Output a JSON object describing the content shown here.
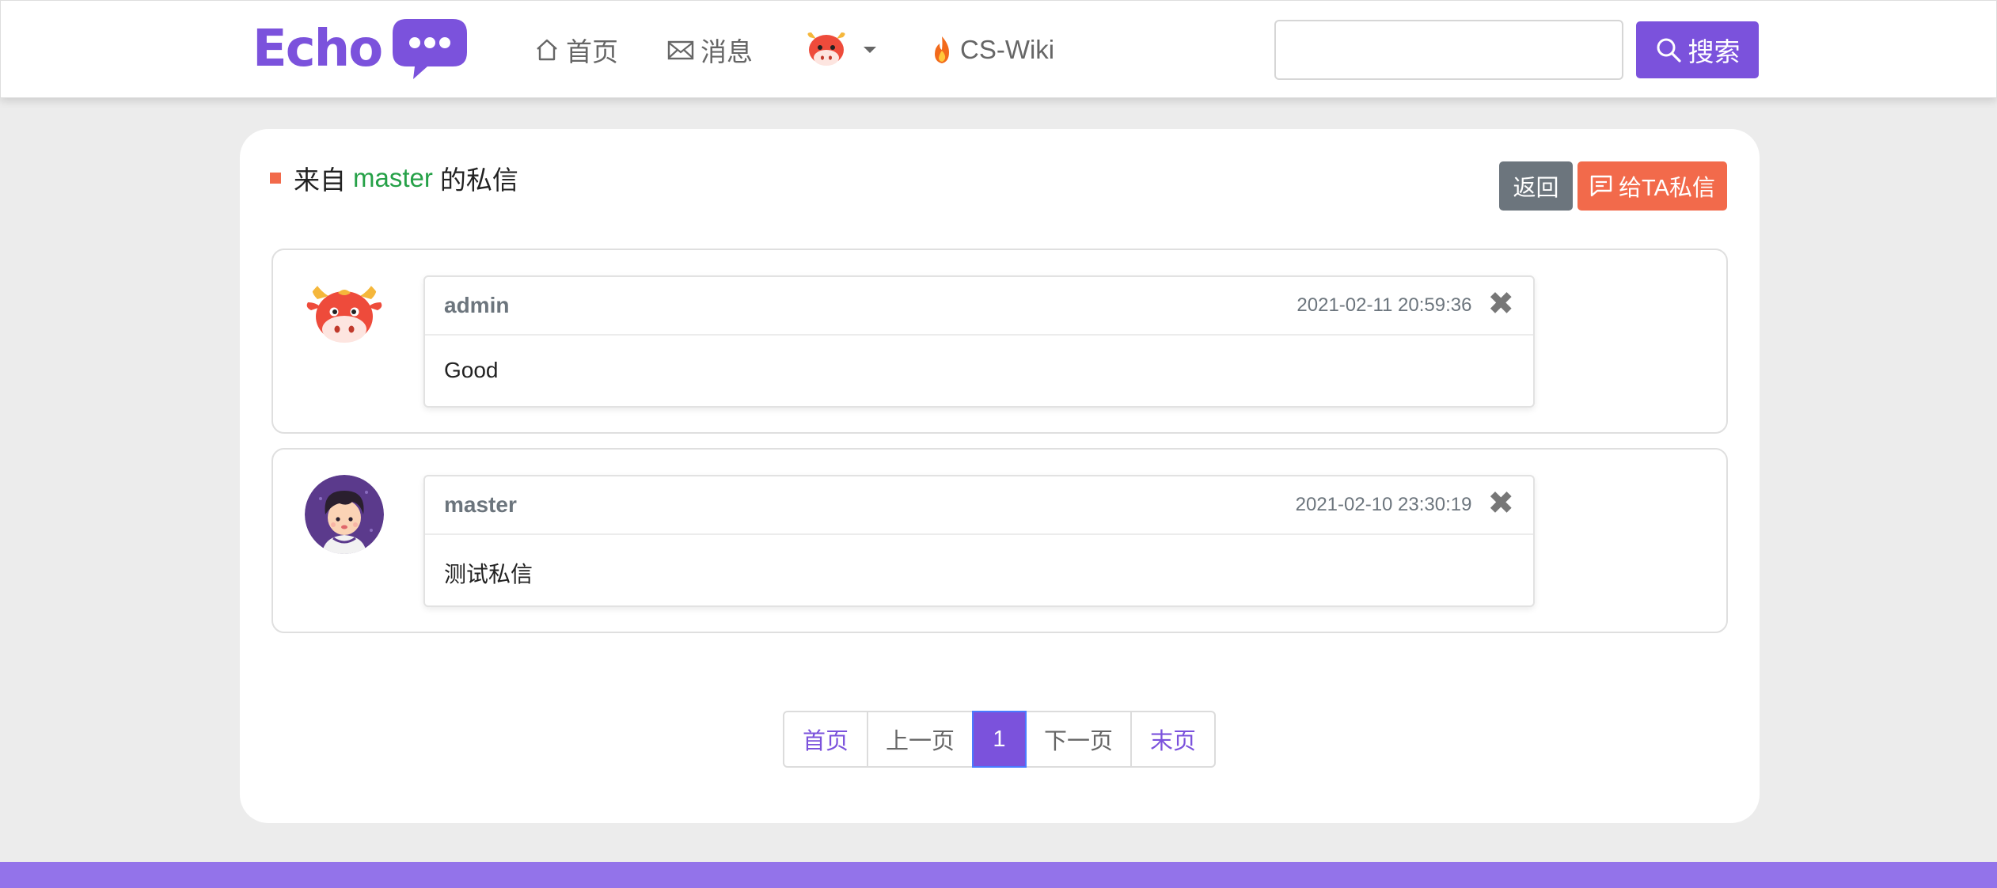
{
  "header": {
    "logo_text": "Echo",
    "nav": {
      "home_label": "首页",
      "messages_label": "消息",
      "wiki_label": "CS-Wiki"
    },
    "search": {
      "value": "",
      "placeholder": ""
    },
    "search_button_label": "搜索"
  },
  "letter": {
    "title_prefix": "来自",
    "title_user": "master",
    "title_suffix": "的私信",
    "back_button_label": "返回",
    "send_button_label": "给TA私信",
    "messages": [
      {
        "from": "admin",
        "time": "2021-02-11 20:59:36",
        "content": "Good",
        "close": "✖",
        "avatar": "cow-avatar"
      },
      {
        "from": "master",
        "time": "2021-02-10 23:30:19",
        "content": "测试私信",
        "close": "✖",
        "avatar": "boy-avatar"
      }
    ]
  },
  "pagination": {
    "first": "首页",
    "prev": "上一页",
    "current": "1",
    "next": "下一页",
    "last": "末页"
  },
  "colors": {
    "brand": "#7b52dc",
    "accent_orange": "#f26a4b",
    "username_green": "#26a148",
    "secondary_gray": "#6c757d",
    "footer": "#9373ea"
  }
}
